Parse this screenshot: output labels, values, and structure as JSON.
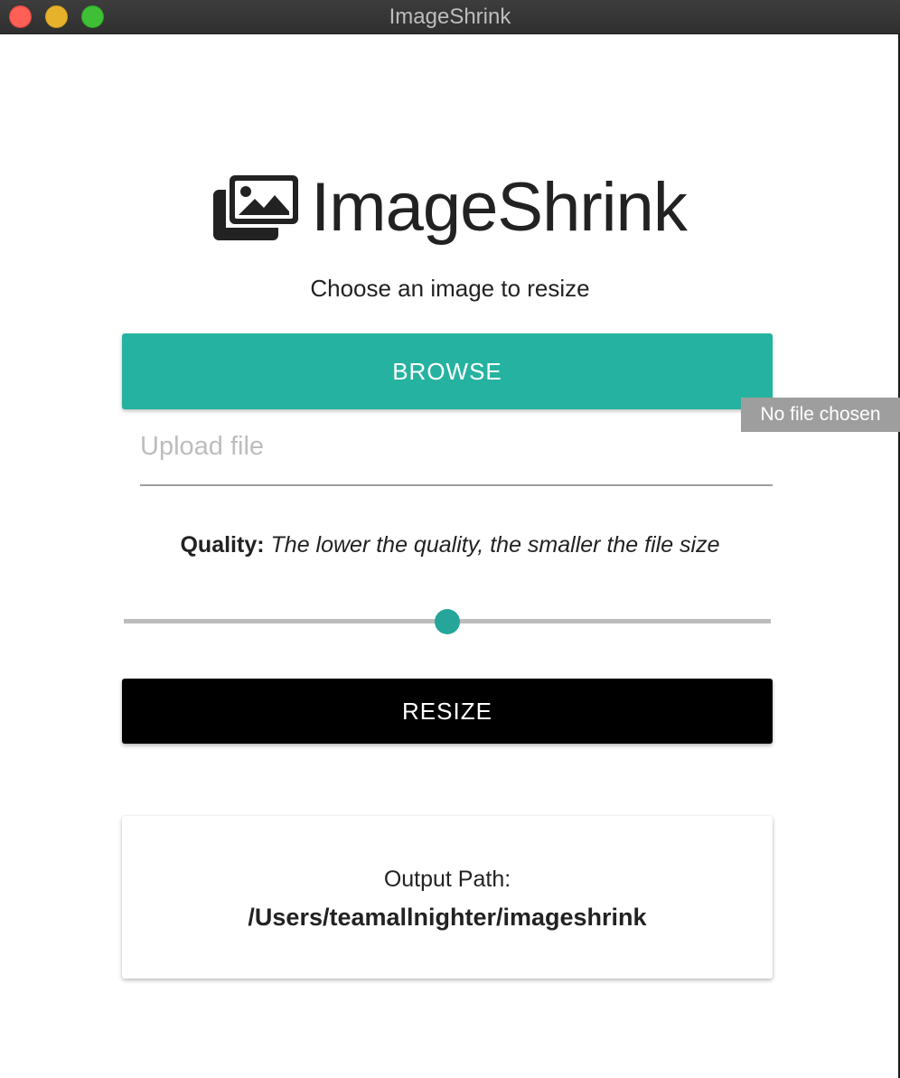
{
  "window": {
    "title": "ImageShrink"
  },
  "header": {
    "logo_icon": "images-icon",
    "app_name": "ImageShrink",
    "subtitle": "Choose an image to resize"
  },
  "file_input": {
    "browse_label": "BROWSE",
    "tooltip": "No file chosen",
    "placeholder": "Upload file",
    "value": ""
  },
  "quality": {
    "label_strong": "Quality:",
    "label_hint": "The lower the quality, the smaller the file size",
    "slider_value_fraction": 0.5
  },
  "actions": {
    "resize_label": "RESIZE"
  },
  "output": {
    "label": "Output Path:",
    "path": "/Users/teamallnighter/imageshrink"
  },
  "colors": {
    "browse_button": "#26b2a0",
    "slider_thumb": "#26a69a",
    "resize_button": "#000000",
    "titlebar": "#333333"
  }
}
